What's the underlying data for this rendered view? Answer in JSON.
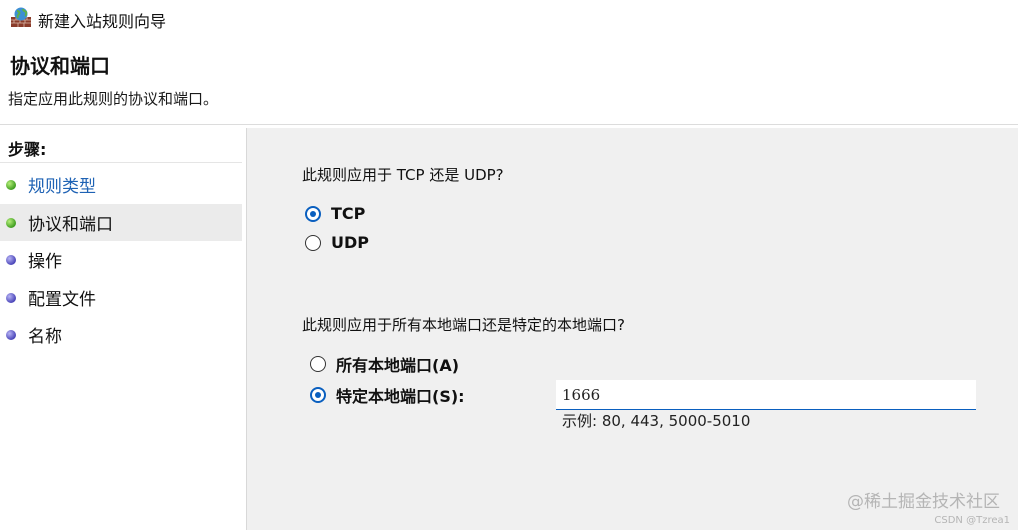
{
  "window": {
    "title": "新建入站规则向导",
    "icon": "firewall-globe-icon"
  },
  "header": {
    "title": "协议和端口",
    "description": "指定应用此规则的协议和端口。"
  },
  "steps": {
    "title": "步骤:",
    "items": [
      {
        "label": "规则类型",
        "status": "completed",
        "dot_color": "#3e9d1f",
        "link": true
      },
      {
        "label": "协议和端口",
        "status": "current",
        "dot_color": "#3e9d1f",
        "link": false
      },
      {
        "label": "操作",
        "status": "pending",
        "dot_color": "#4a45b8",
        "link": false
      },
      {
        "label": "配置文件",
        "status": "pending",
        "dot_color": "#4a45b8",
        "link": false
      },
      {
        "label": "名称",
        "status": "pending",
        "dot_color": "#4a45b8",
        "link": false
      }
    ]
  },
  "protocol": {
    "question": "此规则应用于 TCP 还是 UDP?",
    "options": [
      {
        "label": "TCP",
        "selected": true
      },
      {
        "label": "UDP",
        "selected": false
      }
    ]
  },
  "ports": {
    "question": "此规则应用于所有本地端口还是特定的本地端口?",
    "options": [
      {
        "label": "所有本地端口(A)",
        "selected": false
      },
      {
        "label": "特定本地端口(S):",
        "selected": true
      }
    ],
    "input_value": "1666",
    "example": "示例: 80, 443, 5000-5010"
  },
  "watermark": {
    "line1": "@稀土掘金技术社区",
    "line2": "CSDN @Tzrea1"
  },
  "colors": {
    "accent": "#0a5fbf",
    "link": "#1e62b4",
    "panel_bg": "#f0f0f0"
  }
}
